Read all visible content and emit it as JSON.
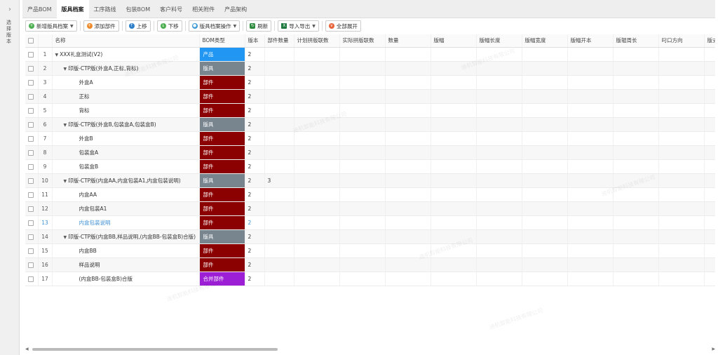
{
  "rail": {
    "toggle_icon": "chevron-right-icon",
    "label": "选择版本"
  },
  "tabs": [
    {
      "label": "产品BOM",
      "active": false
    },
    {
      "label": "版具档案",
      "active": true
    },
    {
      "label": "工序路线",
      "active": false
    },
    {
      "label": "包装BOM",
      "active": false
    },
    {
      "label": "客户料号",
      "active": false
    },
    {
      "label": "相关附件",
      "active": false
    },
    {
      "label": "产品架构",
      "active": false
    }
  ],
  "toolbar": {
    "new_archive": "新增版具档案",
    "add_part": "添加部件",
    "move_up": "上移",
    "move_down": "下移",
    "archive_ops": "版具档案操作",
    "refresh": "刷新",
    "import_export": "导入导出",
    "expand_all": "全部展开"
  },
  "columns": [
    "名称",
    "BOM类型",
    "版本",
    "部件数量",
    "计划拼版联数",
    "实际拼版联数",
    "数量",
    "版幅",
    "版幅长度",
    "版幅宽度",
    "版幅开本",
    "版辊周长",
    "叼口方向",
    "版式"
  ],
  "badge_colors": {
    "产品": "#2196f3",
    "版具": "#78858f",
    "部件": "#8b0000",
    "合并部件": "#9c1fd6"
  },
  "rows": [
    {
      "idx": "1",
      "level": 0,
      "expand": true,
      "name": "XXX礼盒测试(V2)",
      "type": "产品",
      "version": "2",
      "parts": ""
    },
    {
      "idx": "2",
      "level": 1,
      "expand": true,
      "name": "印版-CTP版(外盒A,正标,背标)",
      "type": "版具",
      "version": "2",
      "parts": ""
    },
    {
      "idx": "3",
      "level": 2,
      "expand": false,
      "name": "外盒A",
      "type": "部件",
      "version": "2",
      "parts": ""
    },
    {
      "idx": "4",
      "level": 2,
      "expand": false,
      "name": "正标",
      "type": "部件",
      "version": "2",
      "parts": ""
    },
    {
      "idx": "5",
      "level": 2,
      "expand": false,
      "name": "背标",
      "type": "部件",
      "version": "2",
      "parts": ""
    },
    {
      "idx": "6",
      "level": 1,
      "expand": true,
      "name": "印版-CTP版(外盒B,包装盒A,包装盒B)",
      "type": "版具",
      "version": "2",
      "parts": ""
    },
    {
      "idx": "7",
      "level": 2,
      "expand": false,
      "name": "外盒B",
      "type": "部件",
      "version": "2",
      "parts": ""
    },
    {
      "idx": "8",
      "level": 2,
      "expand": false,
      "name": "包装盒A",
      "type": "部件",
      "version": "2",
      "parts": ""
    },
    {
      "idx": "9",
      "level": 2,
      "expand": false,
      "name": "包装盒B",
      "type": "部件",
      "version": "2",
      "parts": ""
    },
    {
      "idx": "10",
      "level": 1,
      "expand": true,
      "name": "印版-CTP版(内盒AA,内盒包装A1,内盒包装说明)",
      "type": "版具",
      "version": "2",
      "parts": "3"
    },
    {
      "idx": "11",
      "level": 2,
      "expand": false,
      "name": "内盒AA",
      "type": "部件",
      "version": "2",
      "parts": ""
    },
    {
      "idx": "12",
      "level": 2,
      "expand": false,
      "name": "内盒包装A1",
      "type": "部件",
      "version": "2",
      "parts": ""
    },
    {
      "idx": "13",
      "level": 2,
      "expand": false,
      "name": "内盒包装说明",
      "type": "部件",
      "version": "2",
      "parts": "",
      "link": true
    },
    {
      "idx": "14",
      "level": 1,
      "expand": true,
      "name": "印版-CTP版(内盒BB,样品说明,(内盒BB-包装盒B)合版)",
      "type": "版具",
      "version": "2",
      "parts": ""
    },
    {
      "idx": "15",
      "level": 2,
      "expand": false,
      "name": "内盒BB",
      "type": "部件",
      "version": "2",
      "parts": ""
    },
    {
      "idx": "16",
      "level": 2,
      "expand": false,
      "name": "样品说明",
      "type": "部件",
      "version": "2",
      "parts": ""
    },
    {
      "idx": "17",
      "level": 2,
      "expand": false,
      "name": "(内盒BB-包装盒B)合版",
      "type": "合并部件",
      "version": "2",
      "parts": ""
    }
  ]
}
